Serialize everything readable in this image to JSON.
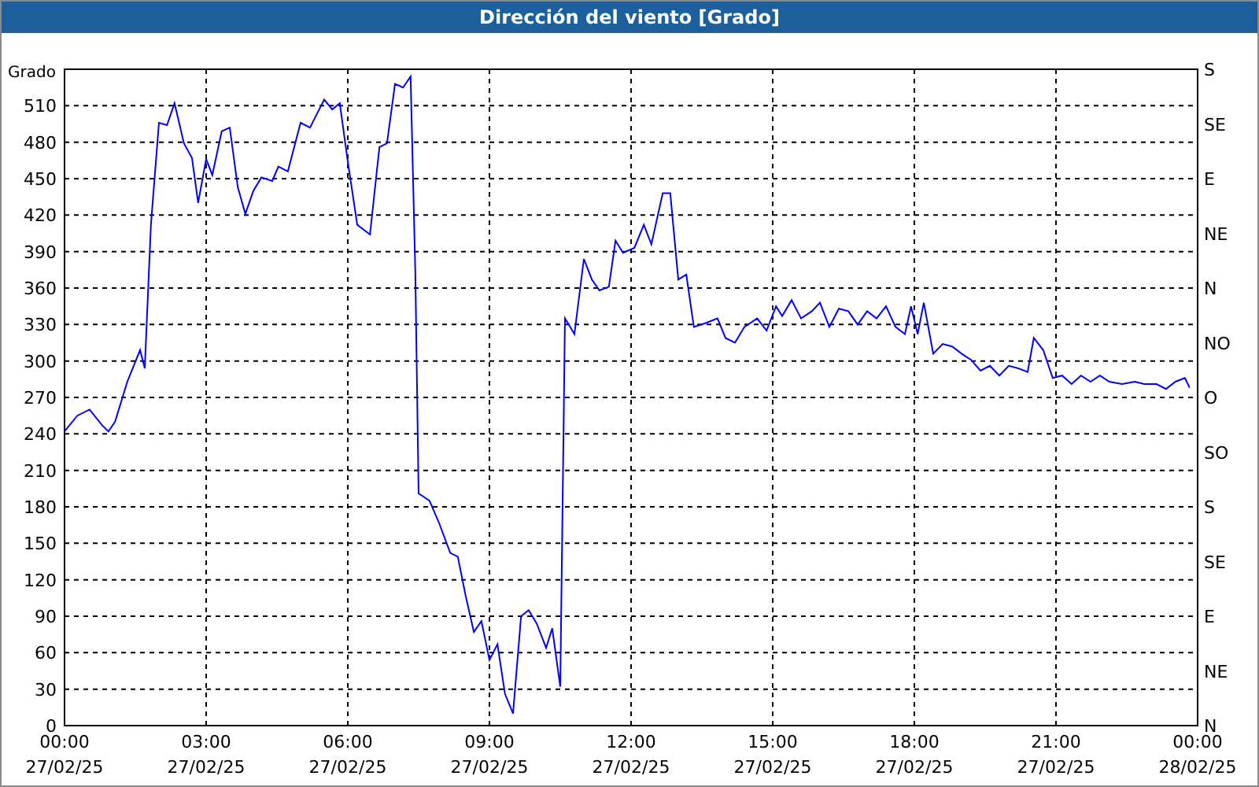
{
  "chart": {
    "chart_data": {
      "type": "line",
      "title": "Dirección del viento [Grado]",
      "ylabel": "Grado",
      "x": [
        0,
        0.27,
        0.53,
        0.8,
        0.93,
        1.07,
        1.33,
        1.6,
        1.7,
        1.83,
        2,
        2.17,
        2.33,
        2.53,
        2.7,
        2.83,
        3,
        3.13,
        3.33,
        3.5,
        3.67,
        3.83,
        4,
        4.17,
        4.4,
        4.53,
        4.73,
        5,
        5.2,
        5.33,
        5.5,
        5.67,
        5.83,
        6,
        6.2,
        6.47,
        6.67,
        6.83,
        7,
        7.17,
        7.33,
        7.43,
        7.5,
        7.73,
        7.93,
        8.17,
        8.33,
        8.5,
        8.67,
        8.83,
        9,
        9.17,
        9.33,
        9.5,
        9.67,
        9.83,
        10,
        10.2,
        10.33,
        10.5,
        10.6,
        10.8,
        11,
        11.17,
        11.33,
        11.53,
        11.67,
        11.83,
        12.07,
        12.27,
        12.43,
        12.67,
        12.83,
        13,
        13.17,
        13.33,
        13.57,
        13.83,
        14,
        14.2,
        14.4,
        14.67,
        14.87,
        15.07,
        15.2,
        15.4,
        15.6,
        15.83,
        16,
        16.2,
        16.4,
        16.6,
        16.8,
        17,
        17.2,
        17.4,
        17.6,
        17.8,
        17.93,
        18.07,
        18.2,
        18.4,
        18.6,
        18.8,
        19,
        19.2,
        19.4,
        19.6,
        19.8,
        20,
        20.2,
        20.4,
        20.53,
        20.73,
        20.93,
        21.13,
        21.33,
        21.53,
        21.73,
        21.93,
        22.13,
        22.4,
        22.67,
        22.87,
        23.13,
        23.33,
        23.53,
        23.73,
        23.83
      ],
      "series": [
        {
          "color": "#0000ff",
          "values": [
            242,
            255,
            260,
            247,
            242,
            250,
            283,
            309,
            294,
            412,
            496,
            494,
            512,
            479,
            467,
            430,
            466,
            453,
            489,
            492,
            443,
            421,
            440,
            451,
            448,
            460,
            456,
            496,
            492,
            502,
            515,
            507,
            512,
            464,
            412,
            404,
            476,
            479,
            528,
            525,
            534,
            373,
            191,
            185,
            167,
            142,
            139,
            106,
            77,
            86,
            54,
            67,
            26,
            10,
            90,
            95,
            84,
            64,
            80,
            32,
            335,
            322,
            384,
            367,
            358,
            361,
            399,
            389,
            393,
            412,
            396,
            438,
            438,
            367,
            371,
            328,
            331,
            335,
            319,
            315,
            328,
            335,
            325,
            345,
            337,
            350,
            335,
            341,
            348,
            328,
            343,
            341,
            330,
            341,
            335,
            345,
            328,
            322,
            345,
            322,
            348,
            306,
            314,
            312,
            306,
            301,
            292,
            296,
            288,
            296,
            294,
            291,
            319,
            309,
            286,
            288,
            281,
            288,
            283,
            288,
            283,
            281,
            283,
            281,
            281,
            277,
            283,
            286,
            278
          ]
        }
      ],
      "xlim": [
        0,
        24
      ],
      "ylim": [
        0,
        540
      ],
      "grid": true,
      "xticks": [
        {
          "value": 0,
          "label": "00:00"
        },
        {
          "value": 3,
          "label": "03:00"
        },
        {
          "value": 6,
          "label": "06:00"
        },
        {
          "value": 9,
          "label": "09:00"
        },
        {
          "value": 12,
          "label": "12:00"
        },
        {
          "value": 15,
          "label": "15:00"
        },
        {
          "value": 18,
          "label": "18:00"
        },
        {
          "value": 21,
          "label": "21:00"
        },
        {
          "value": 24,
          "label": "00:00"
        }
      ],
      "yticks": [
        0,
        30,
        60,
        90,
        120,
        150,
        180,
        210,
        240,
        270,
        300,
        330,
        360,
        390,
        420,
        450,
        480,
        510
      ]
    },
    "date_labels": [
      "27/02/25",
      "27/02/25",
      "27/02/25",
      "27/02/25",
      "27/02/25",
      "27/02/25",
      "27/02/25",
      "27/02/25",
      "28/02/25"
    ],
    "compass_labels": [
      "S",
      "SE",
      "E",
      "NE",
      "N",
      "NO",
      "O",
      "SO",
      "S",
      "SE",
      "E",
      "NE",
      "N"
    ]
  }
}
